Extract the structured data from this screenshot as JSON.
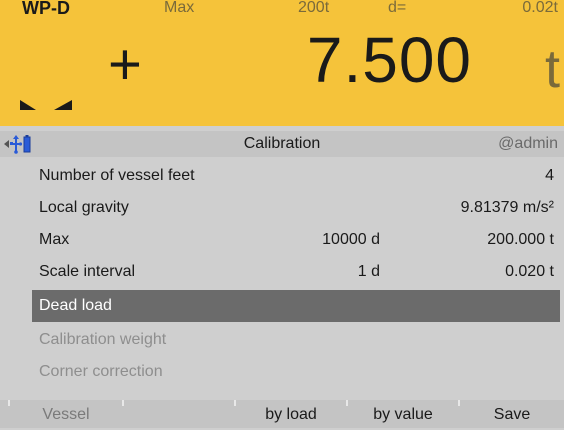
{
  "header": {
    "scale_name": "WP-D",
    "max_label": "Max",
    "max_value": "200t",
    "d_label": "d=",
    "d_value": "0.02t",
    "sign": "+",
    "weight": "7.500",
    "unit": "t",
    "background_color": "#f5c33a"
  },
  "titlebar": {
    "icons": [
      "left-arrow-icon",
      "usb-icon",
      "battery-icon"
    ],
    "title": "Calibration",
    "user": "@admin"
  },
  "menu": {
    "items": [
      {
        "label": "Number of vessel feet",
        "mid": "",
        "value": "4",
        "state": "normal"
      },
      {
        "label": "Local gravity",
        "mid": "",
        "value": "9.81379 m/s²",
        "state": "normal"
      },
      {
        "label": "Max",
        "mid": "10000 d",
        "value": "200.000 t",
        "state": "normal"
      },
      {
        "label": "Scale interval",
        "mid": "1 d",
        "value": "0.020 t",
        "state": "normal"
      },
      {
        "label": "Dead load",
        "mid": "",
        "value": "",
        "state": "selected"
      },
      {
        "label": "Calibration weight",
        "mid": "",
        "value": "",
        "state": "disabled"
      },
      {
        "label": "Corner correction",
        "mid": "",
        "value": "",
        "state": "disabled"
      }
    ]
  },
  "softkeys": {
    "keys": [
      {
        "label": "Vessel",
        "state": "disabled"
      },
      {
        "label": "",
        "state": "empty"
      },
      {
        "label": "by load",
        "state": "normal"
      },
      {
        "label": "by value",
        "state": "normal"
      },
      {
        "label": "Save",
        "state": "normal"
      }
    ]
  }
}
